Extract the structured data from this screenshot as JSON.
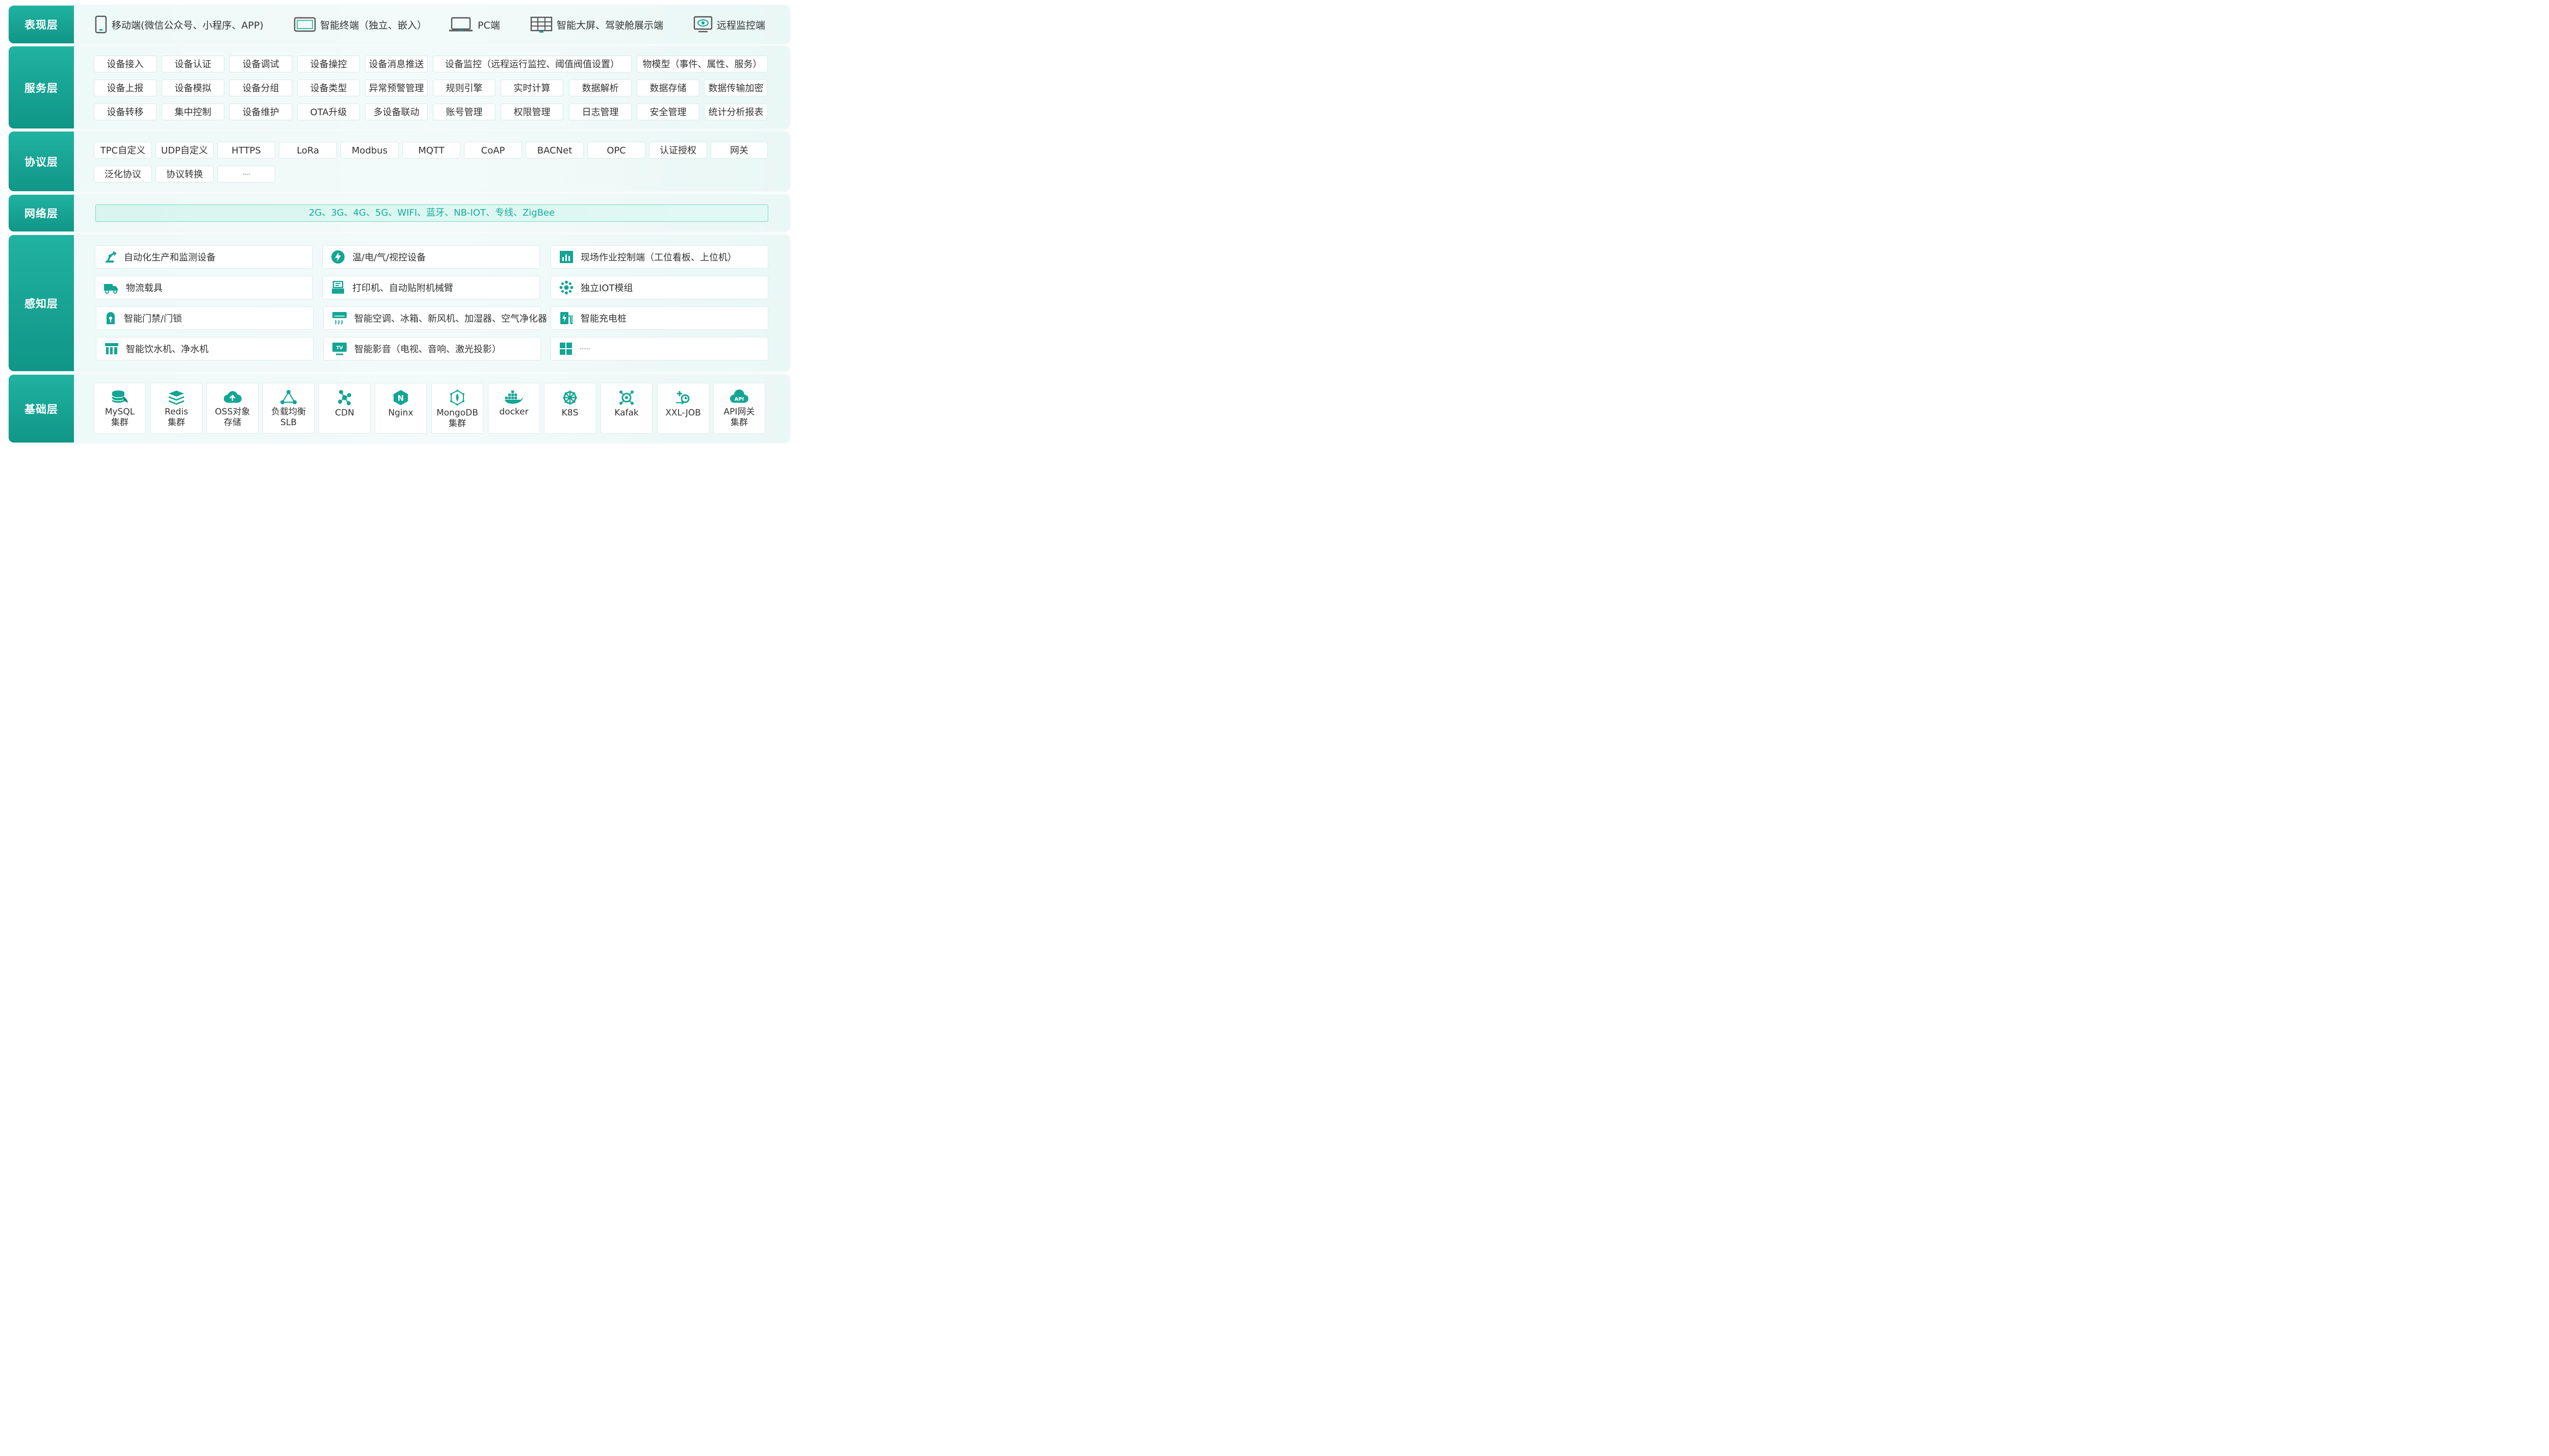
{
  "colors": {
    "accent": "#14a594",
    "label_bg": "#1aa898",
    "net_text": "#18ae9b"
  },
  "presentation": {
    "label": "表现层",
    "items": [
      {
        "icon": "mobile-phone-icon",
        "text": "移动端(微信公众号、小程序、APP)"
      },
      {
        "icon": "tablet-terminal-icon",
        "text": "智能终端（独立、嵌入）"
      },
      {
        "icon": "laptop-icon",
        "text": "PC端"
      },
      {
        "icon": "large-screen-icon",
        "text": "智能大屏、驾驶舱展示端"
      },
      {
        "icon": "remote-monitor-icon",
        "text": "远程监控端"
      }
    ]
  },
  "service": {
    "label": "服务层",
    "rows": [
      [
        "设备接入",
        "设备认证",
        "设备调试",
        "设备操控",
        "设备消息推送",
        "设备监控（远程运行监控、阈值阀值设置）",
        "物模型（事件、属性、服务）"
      ],
      [
        "设备上报",
        "设备模拟",
        "设备分组",
        "设备类型",
        "异常预警管理",
        "规则引擎",
        "实时计算",
        "数据解析",
        "数据存储",
        "数据传输加密"
      ],
      [
        "设备转移",
        "集中控制",
        "设备维护",
        "OTA升级",
        "多设备联动",
        "账号管理",
        "权限管理",
        "日志管理",
        "安全管理",
        "统计分析报表"
      ]
    ]
  },
  "protocol": {
    "label": "协议层",
    "rows": [
      [
        "TPC自定义",
        "UDP自定义",
        "HTTPS",
        "LoRa",
        "Modbus",
        "MQTT",
        "CoAP",
        "BACNet",
        "OPC",
        "认证授权",
        "网关"
      ],
      [
        "泛化协议",
        "协议转换",
        "····"
      ]
    ]
  },
  "network": {
    "label": "网络层",
    "text": "2G、3G、4G、5G、WIFI、蓝牙、NB-IOT、专线、ZigBee"
  },
  "perception": {
    "label": "感知层",
    "items": [
      {
        "icon": "robot-arm-icon",
        "text": "自动化生产和监测设备"
      },
      {
        "icon": "lightning-icon",
        "text": "温/电/气/视控设备"
      },
      {
        "icon": "bar-chart-icon",
        "text": "现场作业控制端（工位看板、上位机）"
      },
      {
        "icon": "truck-icon",
        "text": "物流载具"
      },
      {
        "icon": "printer-icon",
        "text": "打印机、自动贴附机械臂"
      },
      {
        "icon": "iot-module-icon",
        "text": "独立IOT模组"
      },
      {
        "icon": "door-lock-icon",
        "text": "智能门禁/门锁"
      },
      {
        "icon": "air-conditioner-icon",
        "text": "智能空调、冰箱、新风机、加湿器、空气净化器"
      },
      {
        "icon": "charging-pile-icon",
        "text": "智能充电桩"
      },
      {
        "icon": "water-dispenser-icon",
        "text": "智能饮水机、净水机"
      },
      {
        "icon": "tv-icon",
        "text": "智能影音（电视、音响、激光投影）",
        "badge": "TV"
      },
      {
        "icon": "grid-icon",
        "text": "······"
      }
    ]
  },
  "foundation": {
    "label": "基础层",
    "items": [
      {
        "icon": "database-icon",
        "line1": "MySQL",
        "line2": "集群"
      },
      {
        "icon": "stack-icon",
        "line1": "Redis",
        "line2": "集群"
      },
      {
        "icon": "cloud-upload-icon",
        "line1": "OSS对象",
        "line2": "存储"
      },
      {
        "icon": "network-triangle-icon",
        "line1": "负载均衡",
        "line2": "SLB"
      },
      {
        "icon": "cdn-nodes-icon",
        "line1": "CDN",
        "line2": ""
      },
      {
        "icon": "nginx-icon",
        "line1": "Nginx",
        "line2": "",
        "badge": "N"
      },
      {
        "icon": "mongodb-icon",
        "line1": "MongoDB",
        "line2": "集群"
      },
      {
        "icon": "docker-whale-icon",
        "line1": "docker",
        "line2": ""
      },
      {
        "icon": "kubernetes-wheel-icon",
        "line1": "K8S",
        "line2": ""
      },
      {
        "icon": "kafka-icon",
        "line1": "Kafak",
        "line2": ""
      },
      {
        "icon": "job-scheduler-icon",
        "line1": "XXL-JOB",
        "line2": ""
      },
      {
        "icon": "api-cloud-icon",
        "line1": "API网关",
        "line2": "集群",
        "badge": "API"
      }
    ]
  }
}
